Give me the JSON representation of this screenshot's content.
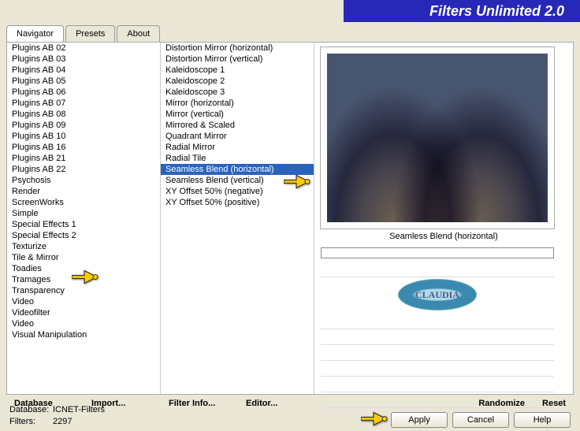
{
  "app_title": "Filters Unlimited 2.0",
  "tabs": [
    "Navigator",
    "Presets",
    "About"
  ],
  "active_tab": 0,
  "category_list": [
    "Plugins AB 02",
    "Plugins AB 03",
    "Plugins AB 04",
    "Plugins AB 05",
    "Plugins AB 06",
    "Plugins AB 07",
    "Plugins AB 08",
    "Plugins AB 09",
    "Plugins AB 10",
    "Plugins AB 16",
    "Plugins AB 21",
    "Plugins AB 22",
    "Psychosis",
    "Render",
    "ScreenWorks",
    "Simple",
    "Special Effects 1",
    "Special Effects 2",
    "Texturize",
    "Tile & Mirror",
    "Toadies",
    "Tramages",
    "Transparency",
    "Video",
    "Videofilter",
    "Video",
    "Visual Manipulation"
  ],
  "category_selected_index": 19,
  "filter_list": [
    "Distortion Mirror (horizontal)",
    "Distortion Mirror (vertical)",
    "Kaleidoscope 1",
    "Kaleidoscope 2",
    "Kaleidoscope 3",
    "Mirror (horizontal)",
    "Mirror (vertical)",
    "Mirrored & Scaled",
    "Quadrant Mirror",
    "Radial Mirror",
    "Radial Tile",
    "Seamless Blend (horizontal)",
    "Seamless Blend (vertical)",
    "XY Offset 50% (negative)",
    "XY Offset 50% (positive)"
  ],
  "filter_selected_index": 11,
  "preview_label": "Seamless Blend (horizontal)",
  "badge_text": "CLAUDIA",
  "buttons_left": [
    "Database",
    "Import...",
    "Filter Info...",
    "Editor..."
  ],
  "buttons_right": [
    "Randomize",
    "Reset"
  ],
  "meta": {
    "db_label": "Database:",
    "db_value": "ICNET-Filters",
    "filters_label": "Filters:",
    "filters_value": "2297"
  },
  "action_buttons": [
    "Apply",
    "Cancel",
    "Help"
  ]
}
